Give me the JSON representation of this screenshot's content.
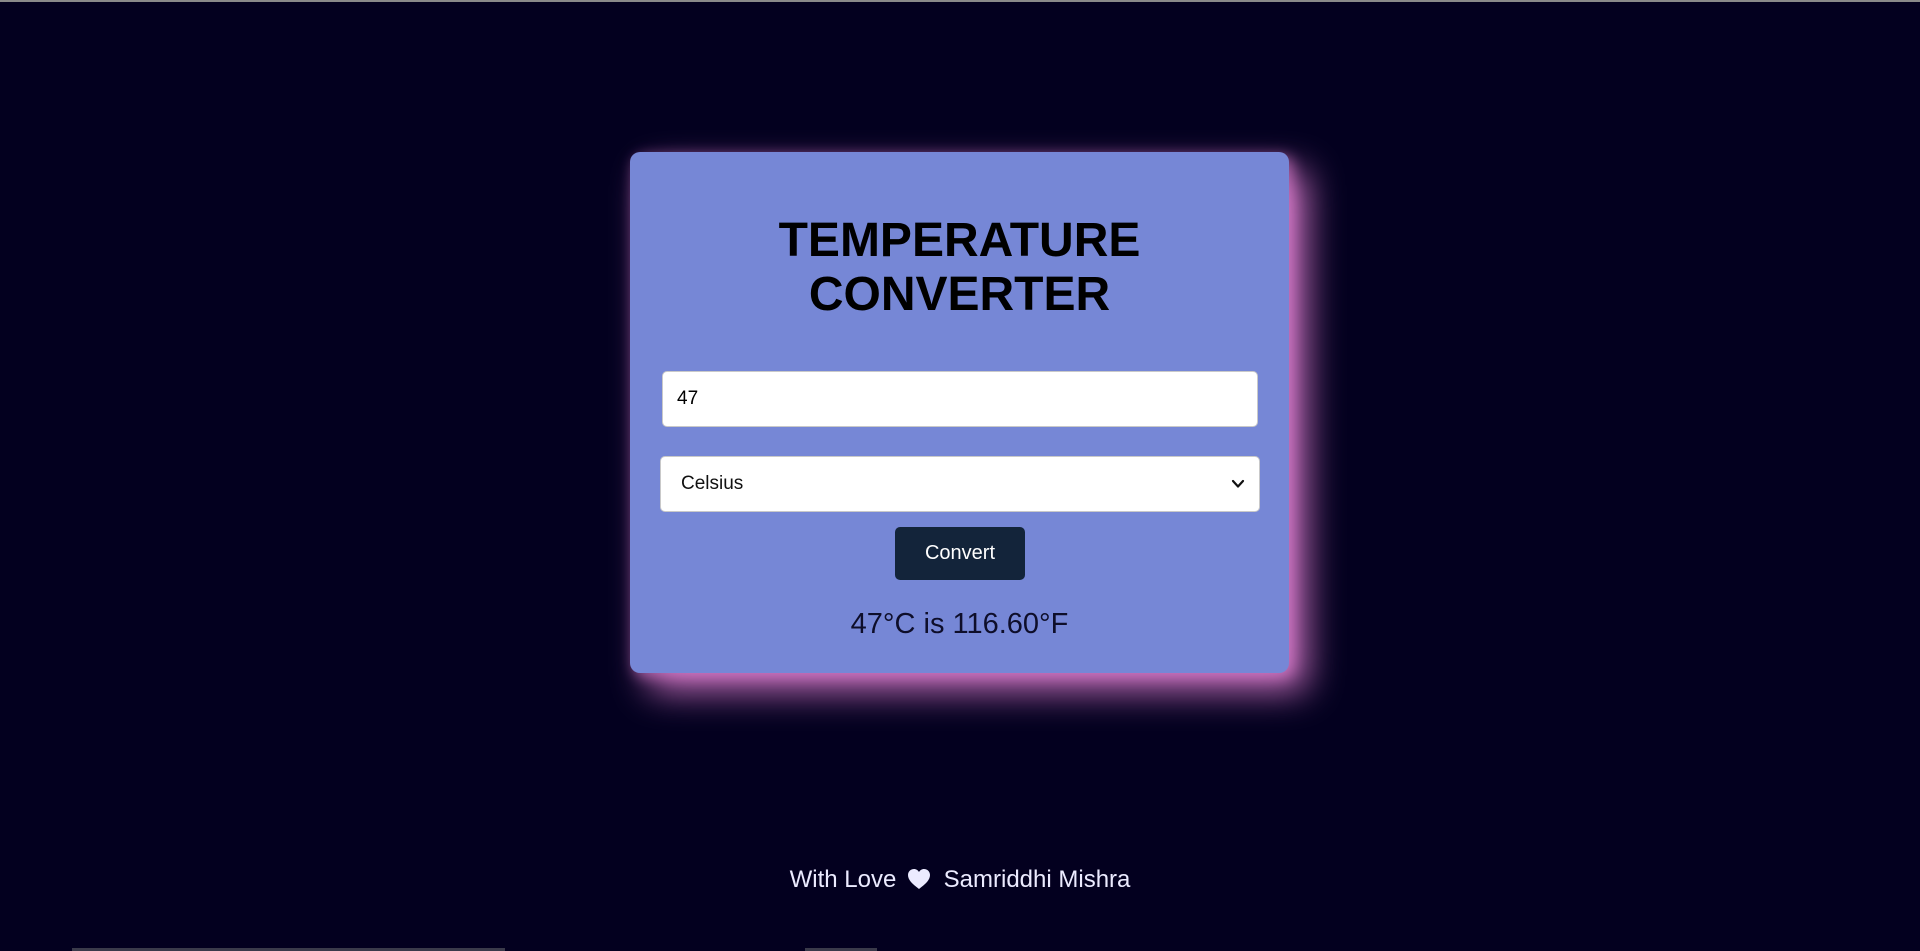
{
  "card": {
    "title_line1": "TEMPERATURE",
    "title_line2": "CONVERTER"
  },
  "form": {
    "temperature_value": "47",
    "unit_selected": "Celsius",
    "convert_label": "Convert"
  },
  "result": {
    "text": "47°C is 116.60°F"
  },
  "footer": {
    "before": "With Love",
    "heart_icon": "heart-icon",
    "after": "Samriddhi Mishra"
  },
  "colors": {
    "background": "#03001f",
    "card": "#7687d6",
    "glow": "#e280d2",
    "button": "#13243a"
  }
}
